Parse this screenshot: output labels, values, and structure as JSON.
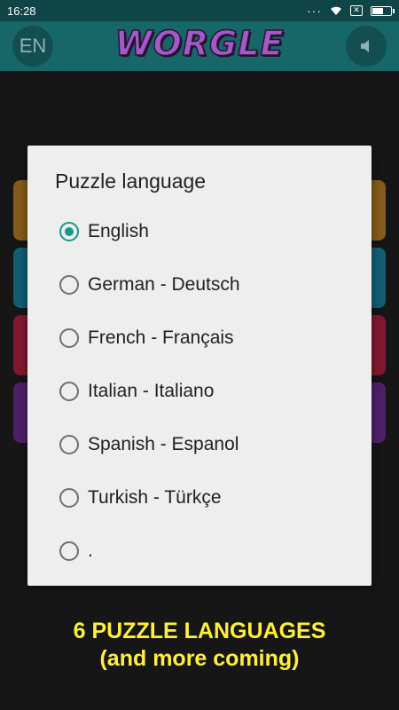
{
  "status_bar": {
    "time": "16:28",
    "icons": [
      "dots-icon",
      "wifi-icon",
      "sim-x-icon",
      "battery-icon"
    ]
  },
  "app_bar": {
    "language_button": "EN",
    "logo": "WORGLE",
    "sound_icon": "speaker-icon"
  },
  "dialog": {
    "title": "Puzzle language",
    "selected": "English",
    "options": [
      {
        "label": "English",
        "checked": true
      },
      {
        "label": "German - Deutsch",
        "checked": false
      },
      {
        "label": "French - Français",
        "checked": false
      },
      {
        "label": "Italian - Italiano",
        "checked": false
      },
      {
        "label": "Spanish - Espanol",
        "checked": false
      },
      {
        "label": "Turkish - Türkçe",
        "checked": false
      },
      {
        "label": ".",
        "checked": false
      }
    ]
  },
  "promo": {
    "line1": "6 PUZZLE LANGUAGES",
    "line2": "(and more coming)"
  },
  "colors": {
    "status_bar": "#0f4546",
    "app_bar": "#176668",
    "accent": "#149b8a",
    "promo_text": "#ffef3a",
    "logo": "#a15ac8",
    "tile_orange": "#b07a23",
    "tile_blue": "#1a7d9b",
    "tile_red": "#b01f3f",
    "tile_purple": "#6a2a8a"
  }
}
